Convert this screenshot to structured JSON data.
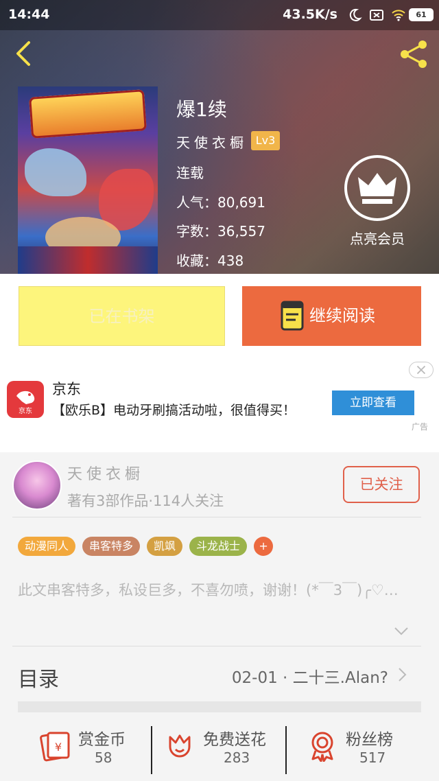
{
  "status_bar": {
    "time": "14:44",
    "network_speed": "43.5K/s",
    "battery": "61"
  },
  "book": {
    "title": "爆1续",
    "author": "天使衣橱",
    "author_level": "Lv3",
    "status": "连载",
    "popularity": "人气：80,691",
    "word_count": "字数：36,557",
    "favorites": "收藏：438"
  },
  "vip": {
    "label": "点亮会员"
  },
  "actions": {
    "shelf_label": "已在书架",
    "read_label": "继续阅读"
  },
  "ad": {
    "brand": "京东",
    "logo_text": "京东",
    "description": "【欧乐B】电动牙刷搞活动啦，很值得买！",
    "cta": "立即查看",
    "tag": "广告"
  },
  "author_card": {
    "name": "天使衣橱",
    "stats": "著有3部作品·114人关注",
    "follow_label": "已关注"
  },
  "tags": [
    {
      "label": "动漫同人",
      "color": "#f2a83c"
    },
    {
      "label": "串客特多",
      "color": "#c98463"
    },
    {
      "label": "凯飒",
      "color": "#d4a042"
    },
    {
      "label": "斗龙战士",
      "color": "#9bb34a"
    }
  ],
  "tag_add": "+",
  "description": "此文串客特多，私设巨多，不喜勿喷，谢谢！(*￣3￣)╭♡…",
  "toc": {
    "label": "目录",
    "latest": "02-01 · 二十三.Alan?"
  },
  "bottom_stats": [
    {
      "label": "赏金币",
      "value": "58"
    },
    {
      "label": "免费送花",
      "value": "283"
    },
    {
      "label": "粉丝榜",
      "value": "517"
    }
  ],
  "colors": {
    "accent_orange": "#ec6a3f",
    "shelf_yellow": "#fdf57c",
    "icon_yellow": "#f7e14a",
    "ad_blue": "#2f8fd8",
    "icon_red": "#d9442e"
  }
}
